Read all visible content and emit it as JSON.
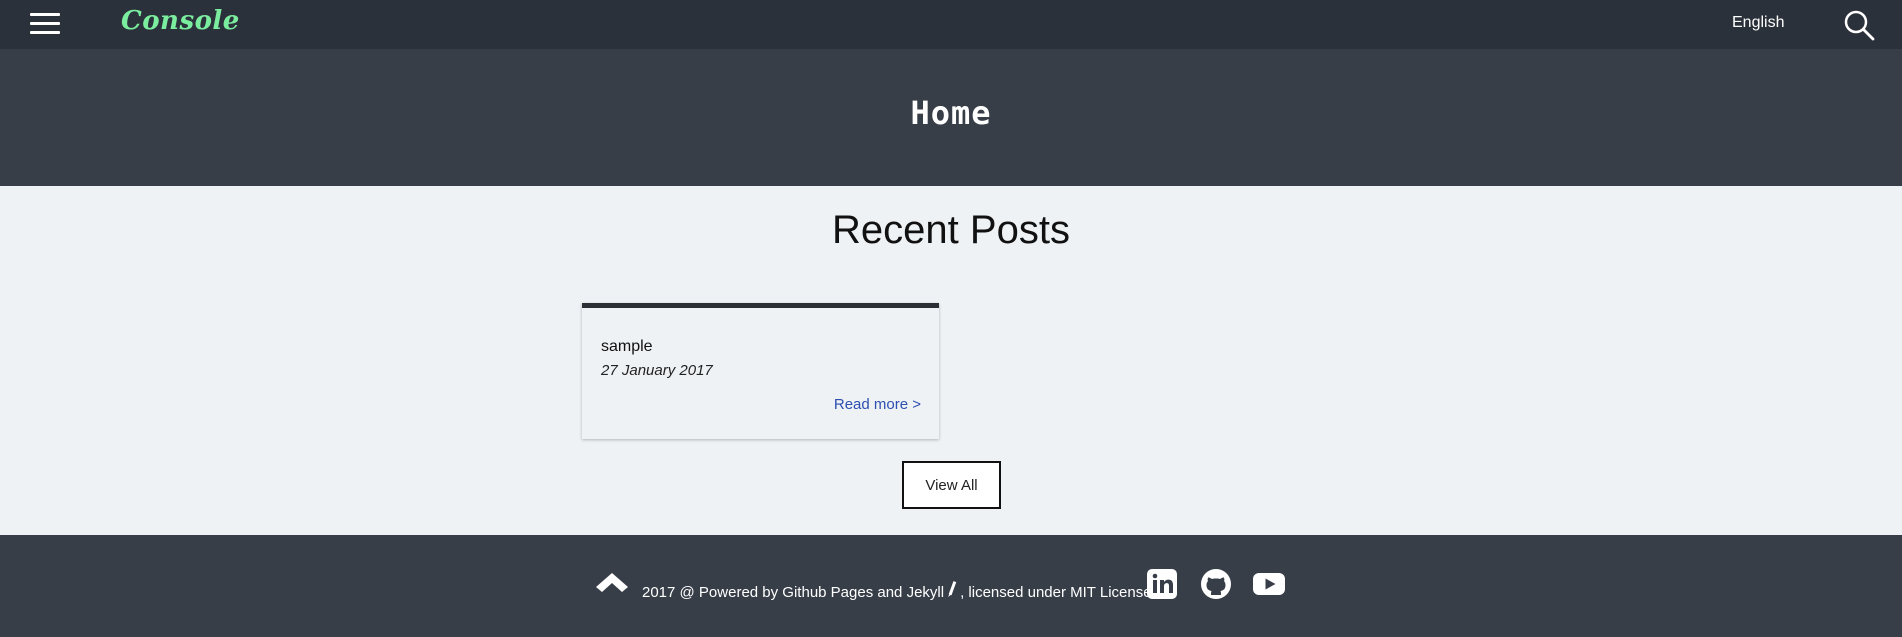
{
  "navbar": {
    "menu_icon": "hamburger-menu-icon",
    "brand": "Console",
    "brand_color": "#7bed9f",
    "language": "English",
    "search_icon": "search-icon"
  },
  "hero": {
    "title": "Home"
  },
  "main": {
    "section_title": "Recent Posts",
    "posts": [
      {
        "title": "sample",
        "date": "27 January 2017",
        "read_more": "Read more >"
      }
    ],
    "view_all": "View All",
    "link_color": "#2d4fb0"
  },
  "footer": {
    "up_icon": "arrow-up-icon",
    "text_before": "2017 @ Powered by Github Pages and Jekyll",
    "pencil_icon": "pencil-icon",
    "text_after": ", licensed under MIT License.",
    "social": [
      {
        "icon": "linkedin-icon"
      },
      {
        "icon": "github-icon"
      },
      {
        "icon": "youtube-icon"
      }
    ]
  },
  "colors": {
    "navbar_bg": "#2b313a",
    "hero_bg": "#373e48",
    "content_bg": "#eef2f5",
    "footer_bg": "#373e48"
  }
}
